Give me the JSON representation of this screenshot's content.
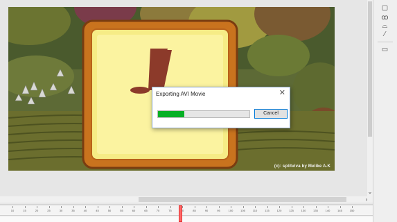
{
  "dialog": {
    "title": "Exporting AVI Movie",
    "close_glyph": "✕",
    "progress_fraction": 0.29,
    "cancel_label": "Cancel"
  },
  "stage": {
    "credit": "(c): splitviva by Melike A.K"
  },
  "timeline": {
    "ticks": [
      "10",
      "15",
      "20",
      "25",
      "30",
      "35",
      "40",
      "45",
      "50",
      "55",
      "60",
      "65",
      "70",
      "75",
      "80",
      "85",
      "90",
      "95",
      "100",
      "105",
      "110",
      "115",
      "120",
      "125",
      "130",
      "135",
      "140",
      "145",
      "150"
    ],
    "playhead_frame": 78
  },
  "toolbar": {
    "icons": [
      "square-tool-icon",
      "ink-bottle-icon",
      "paint-bucket-icon",
      "eyedropper-icon",
      "eraser-icon"
    ]
  },
  "colors": {
    "progress": "#06b025",
    "dialog_border": "#8aa6c8",
    "button_border": "#0078d7",
    "playhead": "#ff6a6a"
  }
}
